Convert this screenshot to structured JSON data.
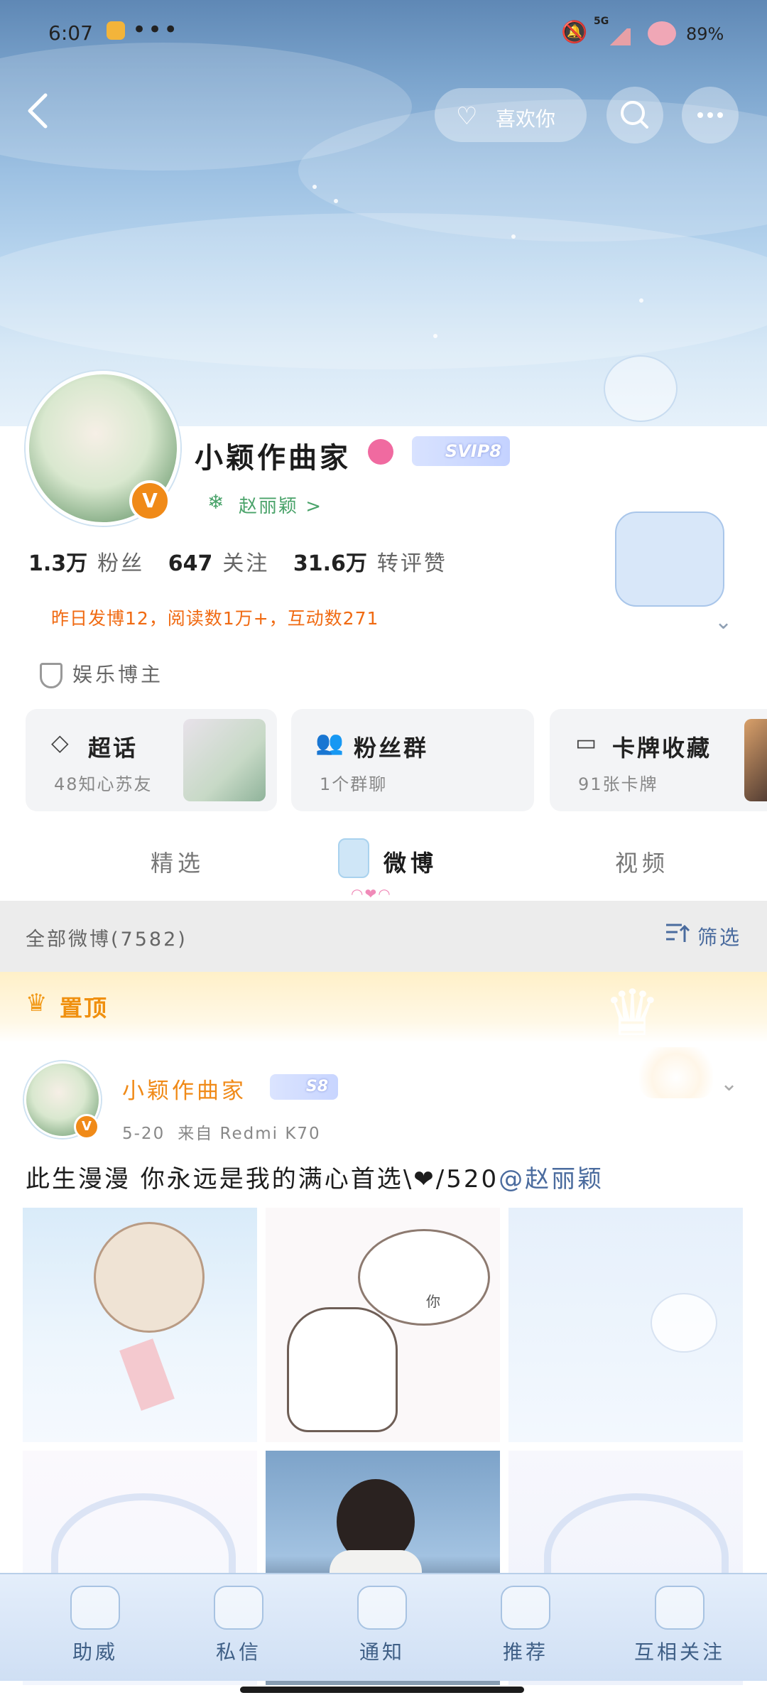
{
  "status_bar": {
    "time": "6:07",
    "more": "•••",
    "network": "5G",
    "battery": "89%"
  },
  "header": {
    "like_label": "喜欢你"
  },
  "profile": {
    "name": "小颖作曲家",
    "vip_badge": "SVIP8",
    "tag_label": "赵丽颖 >",
    "verified_mark": "V",
    "stats": [
      {
        "value": "1.3万",
        "label": "粉丝"
      },
      {
        "value": "647",
        "label": "关注"
      },
      {
        "value": "31.6万",
        "label": "转评赞"
      }
    ],
    "summary": "昨日发博12，阅读数1万+，互动数271",
    "identity": "娱乐博主"
  },
  "cards": [
    {
      "title": "超话",
      "subtitle": "48知心苏友",
      "icon": "diamond-icon"
    },
    {
      "title": "粉丝群",
      "subtitle": "1个群聊",
      "icon": "group-icon"
    },
    {
      "title": "卡牌收藏",
      "subtitle": "91张卡牌",
      "icon": "card-icon"
    }
  ],
  "tabs": [
    {
      "label": "精选"
    },
    {
      "label": "微博",
      "active": true
    },
    {
      "label": "视频"
    }
  ],
  "filter": {
    "all_label": "全部微博(7582)",
    "filter_label": "筛选"
  },
  "pinned": {
    "label": "置顶"
  },
  "post": {
    "author": "小颖作曲家",
    "level_badge": "S8",
    "date": "5-20",
    "source": "来自 Redmi K70",
    "text_main": "此生漫漫 你永远是我的满心首选",
    "text_heart": "\\❤/",
    "text_num": "520",
    "mention": "@赵丽颖",
    "image_label": "你"
  },
  "bottom_nav": [
    {
      "label": "助威",
      "icon": "candy-icon"
    },
    {
      "label": "私信",
      "icon": "gift-icon"
    },
    {
      "label": "通知",
      "icon": "bottle-icon"
    },
    {
      "label": "推荐",
      "icon": "basket-icon"
    },
    {
      "label": "互相关注",
      "icon": "lamp-icon"
    }
  ],
  "colors": {
    "accent": "#f08a18",
    "link": "#4a6b9e",
    "summary_text": "#f06a12"
  }
}
